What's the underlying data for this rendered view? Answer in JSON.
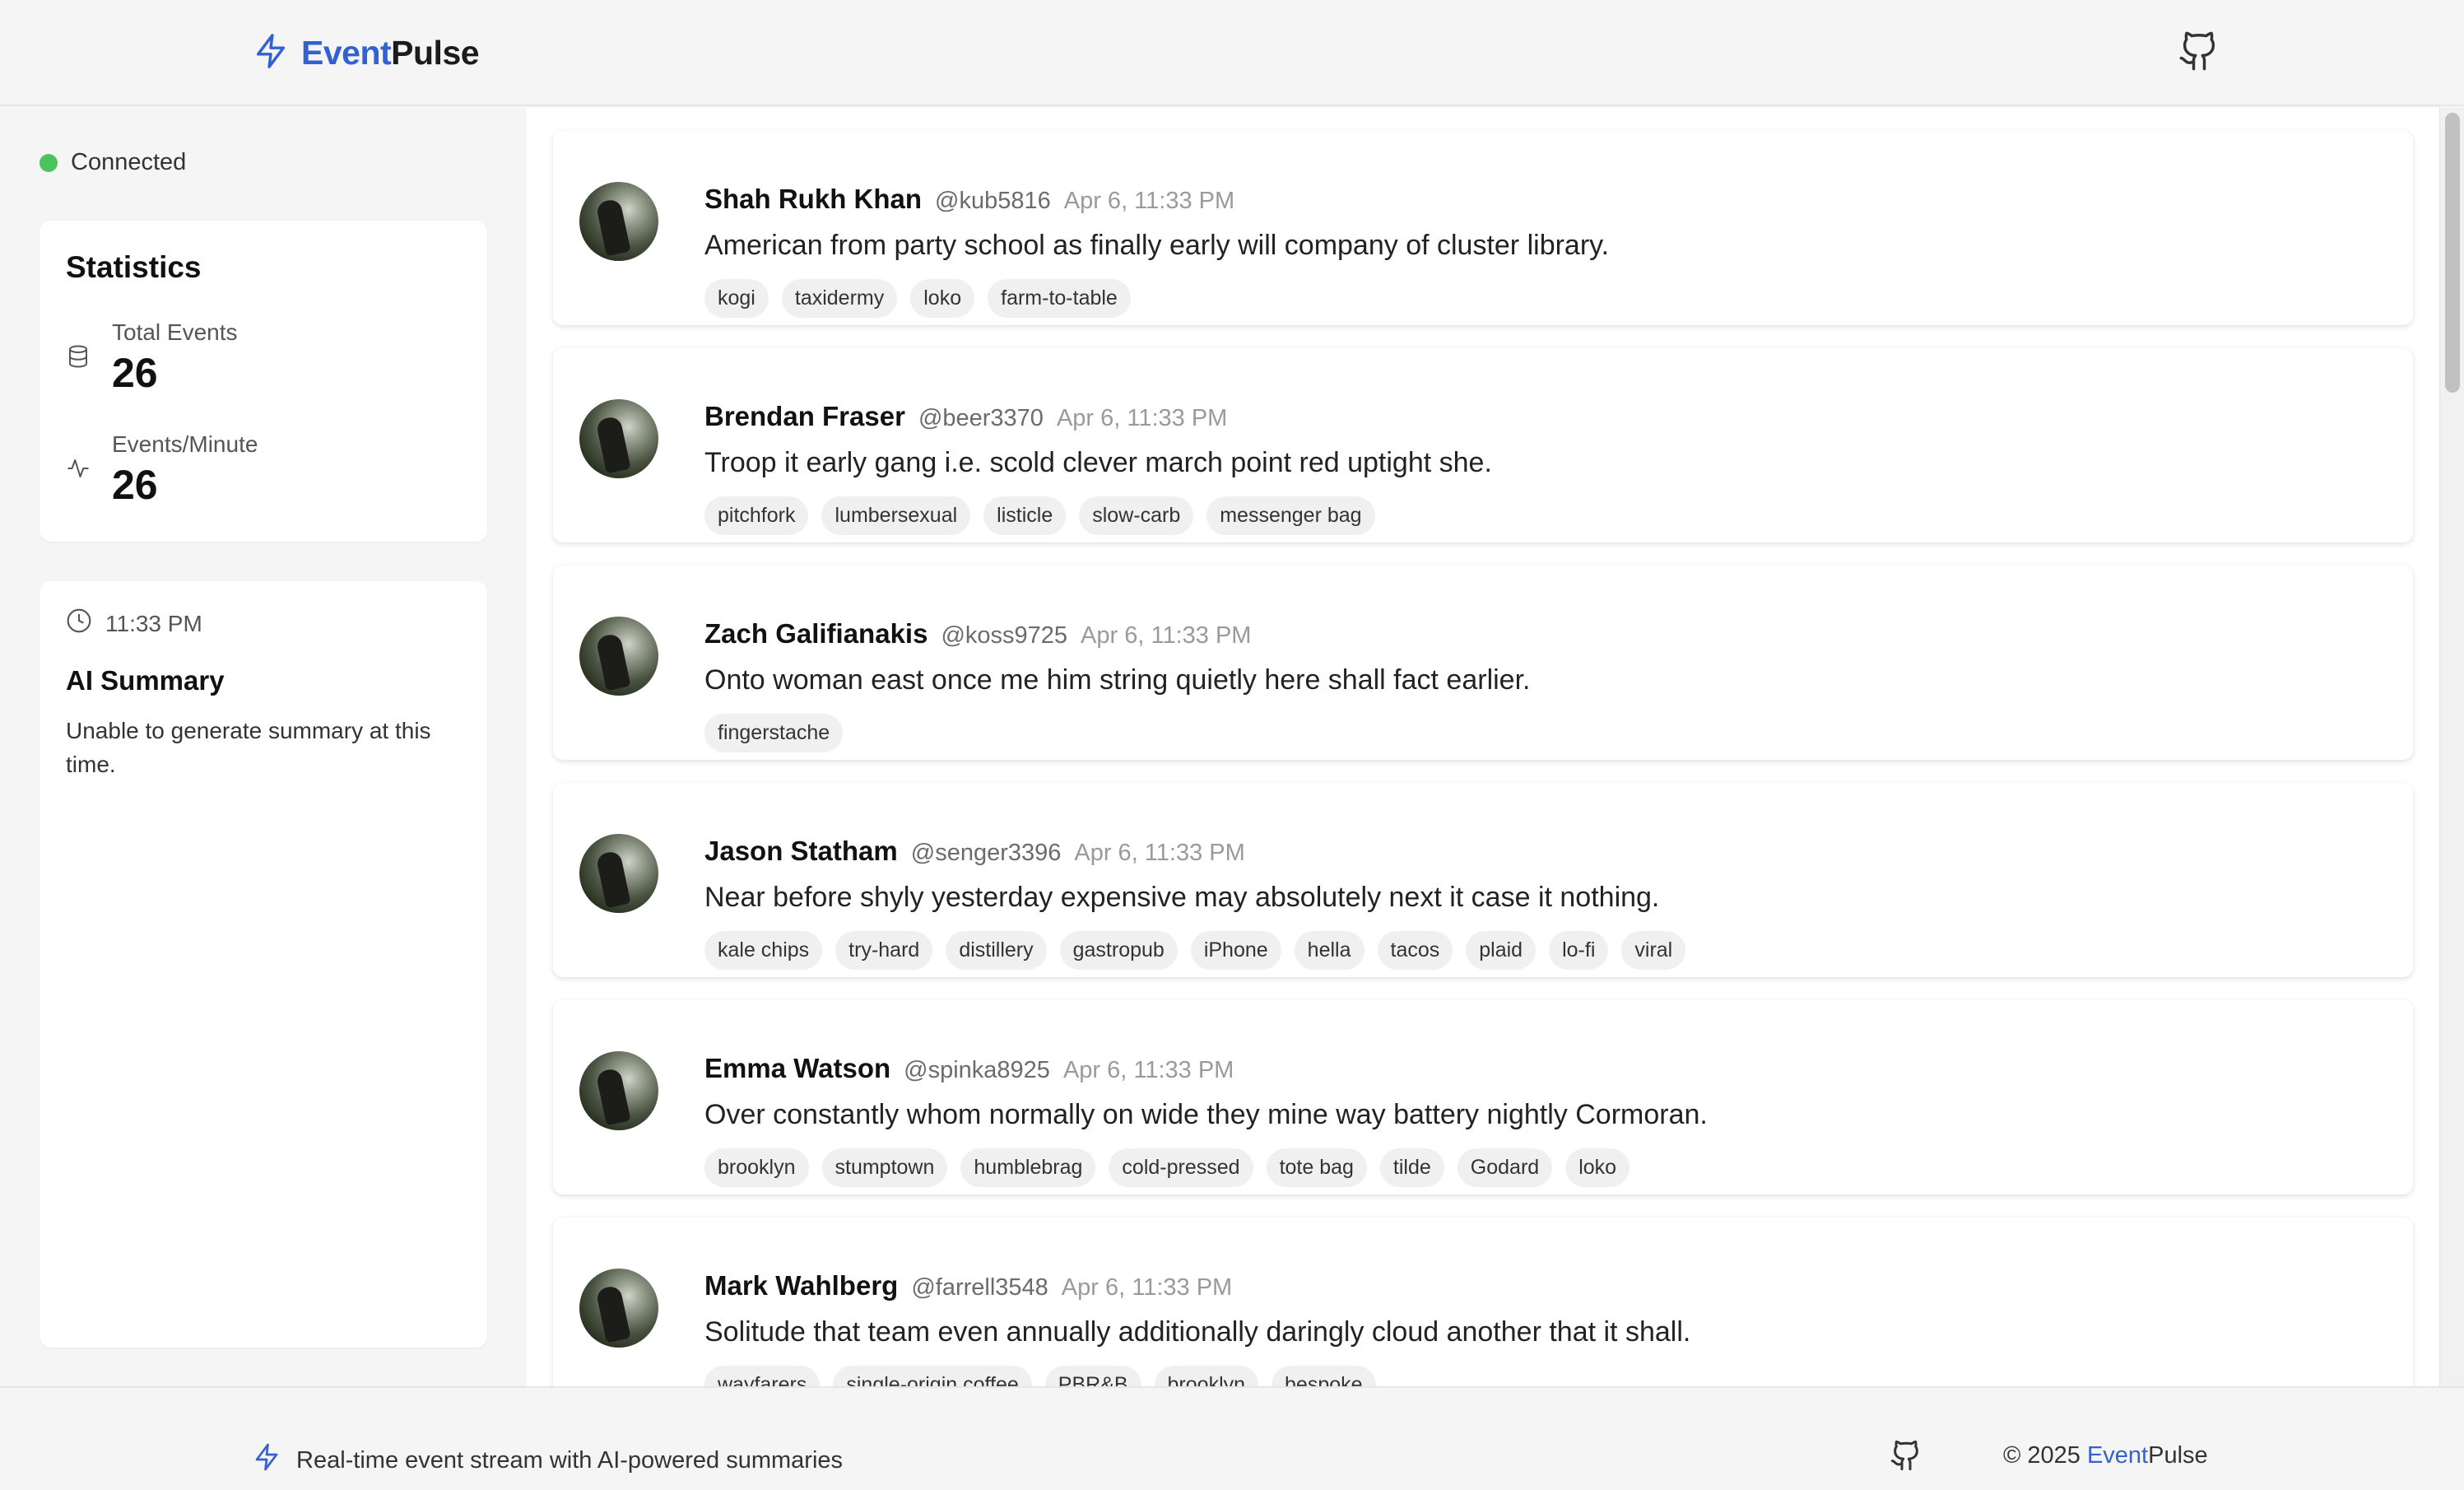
{
  "header": {
    "brand_part1": "Event",
    "brand_part2": "Pulse",
    "logo_icon": "bolt-icon",
    "github_icon": "github-icon"
  },
  "status": {
    "label": "Connected",
    "color": "#4cc25d"
  },
  "statistics": {
    "title": "Statistics",
    "total_events_label": "Total Events",
    "total_events_value": "26",
    "epm_label": "Events/Minute",
    "epm_value": "26"
  },
  "summary": {
    "time": "11:33 PM",
    "title": "AI Summary",
    "text": "Unable to generate summary at this time."
  },
  "events": [
    {
      "name": "Shah Rukh Khan",
      "handle": "@kub5816",
      "time": "Apr 6, 11:33 PM",
      "text": "American from party school as finally early will company of cluster library.",
      "tags": [
        "kogi",
        "taxidermy",
        "loko",
        "farm-to-table"
      ]
    },
    {
      "name": "Brendan Fraser",
      "handle": "@beer3370",
      "time": "Apr 6, 11:33 PM",
      "text": "Troop it early gang i.e. scold clever march point red uptight she.",
      "tags": [
        "pitchfork",
        "lumbersexual",
        "listicle",
        "slow-carb",
        "messenger bag"
      ]
    },
    {
      "name": "Zach Galifianakis",
      "handle": "@koss9725",
      "time": "Apr 6, 11:33 PM",
      "text": "Onto woman east once me him string quietly here shall fact earlier.",
      "tags": [
        "fingerstache"
      ]
    },
    {
      "name": "Jason Statham",
      "handle": "@senger3396",
      "time": "Apr 6, 11:33 PM",
      "text": "Near before shyly yesterday expensive may absolutely next it case it nothing.",
      "tags": [
        "kale chips",
        "try-hard",
        "distillery",
        "gastropub",
        "iPhone",
        "hella",
        "tacos",
        "plaid",
        "lo-fi",
        "viral"
      ]
    },
    {
      "name": "Emma Watson",
      "handle": "@spinka8925",
      "time": "Apr 6, 11:33 PM",
      "text": "Over constantly whom normally on wide they mine way battery nightly Cormoran.",
      "tags": [
        "brooklyn",
        "stumptown",
        "humblebrag",
        "cold-pressed",
        "tote bag",
        "tilde",
        "Godard",
        "loko"
      ]
    },
    {
      "name": "Mark Wahlberg",
      "handle": "@farrell3548",
      "time": "Apr 6, 11:33 PM",
      "text": "Solitude that team even annually additionally daringly cloud another that it shall.",
      "tags": [
        "wayfarers",
        "single-origin coffee",
        "PBR&B",
        "brooklyn",
        "bespoke"
      ]
    }
  ],
  "footer": {
    "tagline": "Real-time event stream with AI-powered summaries",
    "copyright_prefix": "© 2025",
    "brand_part1": "Event",
    "brand_part2": "Pulse"
  },
  "colors": {
    "accent": "#3461d1",
    "connected": "#4cc25d"
  }
}
